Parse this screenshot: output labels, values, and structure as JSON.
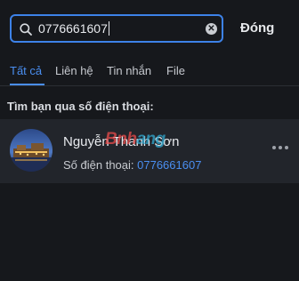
{
  "search": {
    "value": "0776661607"
  },
  "close_label": "Đóng",
  "tabs": [
    {
      "label": "Tất cả",
      "active": true
    },
    {
      "label": "Liên hệ",
      "active": false
    },
    {
      "label": "Tin nhắn",
      "active": false
    },
    {
      "label": "File",
      "active": false
    }
  ],
  "section_title": "Tìm bạn qua số điện thoại:",
  "result": {
    "name": "Nguyễn Thanh Sơn",
    "phone_label": "Số điện thoại:",
    "phone_number": "0776661607",
    "watermark": "Bnhang"
  },
  "icons": {
    "search": "search-icon",
    "clear": "clear-icon",
    "more": "more-icon"
  },
  "colors": {
    "accent": "#4a8ef0",
    "background": "#16181c",
    "row_background": "#22252b"
  }
}
